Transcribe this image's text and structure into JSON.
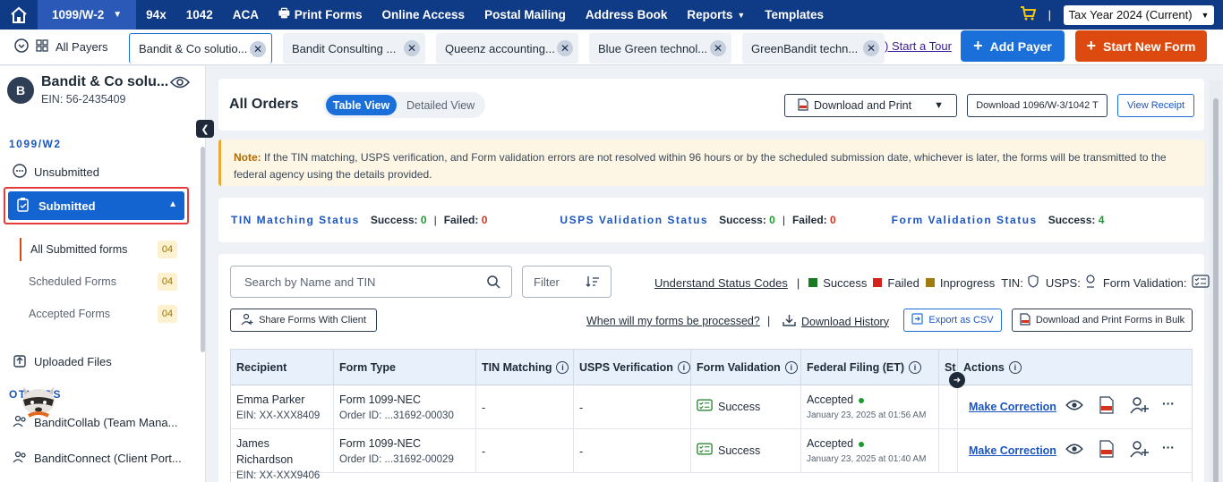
{
  "topnav": {
    "form_selector": "1099/W-2",
    "items": [
      "94x",
      "1042",
      "ACA",
      "Print Forms",
      "Online Access",
      "Postal Mailing",
      "Address Book",
      "Reports",
      "Templates"
    ],
    "tax_year": "Tax Year 2024 (Current)"
  },
  "tabbar": {
    "all_payers": "All Payers",
    "tabs": [
      "Bandit & Co solutio...",
      "Bandit Consulting ...",
      "Queenz accounting...",
      "Blue Green technol...",
      "GreenBandit techn..."
    ],
    "start_tour": ") Start a Tour",
    "add_payer": "Add Payer",
    "start_new_form": "Start New Form"
  },
  "sidebar": {
    "avatar_letter": "B",
    "payer_name": "Bandit & Co solu...",
    "ein": "EIN: 56-2435409",
    "section": "1099/W2",
    "unsubmitted": "Unsubmitted",
    "submitted": "Submitted",
    "sub_items": [
      {
        "label": "All Submitted forms",
        "count": "04"
      },
      {
        "label": "Scheduled Forms",
        "count": "04"
      },
      {
        "label": "Accepted Forms",
        "count": "04"
      }
    ],
    "uploaded_files": "Uploaded Files",
    "others": "OTHERS",
    "collab": "BanditCollab (Team Mana...",
    "connect": "BanditConnect (Client Port..."
  },
  "main": {
    "title": "All Orders",
    "table_view": "Table View",
    "detailed_view": "Detailed View",
    "download_print": "Download and Print",
    "download_1096": "Download 1096/W-3/1042 T",
    "view_receipt": "View Receipt",
    "note_label": "Note:",
    "note_text": "If the TIN matching, USPS verification, and Form validation errors are not resolved within 96 hours or by the scheduled submission date, whichever is later, the forms will be transmitted to the federal agency using the details provided."
  },
  "status": {
    "tin_label": "TIN Matching Status",
    "tin_success": "0",
    "tin_failed": "0",
    "usps_label": "USPS Validation Status",
    "usps_success": "0",
    "usps_failed": "0",
    "form_label": "Form Validation Status",
    "form_success": "4",
    "success_word": "Success:",
    "failed_word": "Failed:"
  },
  "toolbar": {
    "search_placeholder": "Search by Name and TIN",
    "filter": "Filter",
    "understand": "Understand Status Codes",
    "legend_success": "Success",
    "legend_failed": "Failed",
    "legend_inprogress": "Inprogress",
    "tin": "TIN:",
    "usps": "USPS:",
    "form_validation": "Form Validation:",
    "share": "Share Forms With Client",
    "when": "When will my forms be processed?",
    "download_history": "Download History",
    "export_csv": "Export as CSV",
    "bulk": "Download and Print Forms in Bulk"
  },
  "table": {
    "headers": [
      "Recipient",
      "Form Type",
      "TIN Matching",
      "USPS Verification",
      "Form Validation",
      "Federal Filing (ET)",
      "St",
      "Actions"
    ],
    "rows": [
      {
        "name": "Emma Parker",
        "ein": "EIN: XX-XXX8409",
        "form": "Form 1099-NEC",
        "order": "Order ID:  ...31692-00030",
        "tin": "-",
        "usps": "-",
        "validation": "Success",
        "filing": "Accepted",
        "date": "January 23, 2025 at 01:56 AM",
        "action": "Make Correction"
      },
      {
        "name": "James Richardson",
        "ein": "EIN: XX-XXX9406",
        "form": "Form 1099-NEC",
        "order": "Order ID:  ...31692-00029",
        "tin": "-",
        "usps": "-",
        "validation": "Success",
        "filing": "Accepted",
        "date": "January 23, 2025 at 01:40 AM",
        "action": "Make Correction"
      }
    ]
  },
  "colors": {
    "nav": "#0f3a86",
    "accent": "#1a6fd9",
    "orange": "#dc4a0f",
    "success": "#1c9a2e",
    "failed": "#d6331c",
    "inprogress": "#a07c10"
  }
}
